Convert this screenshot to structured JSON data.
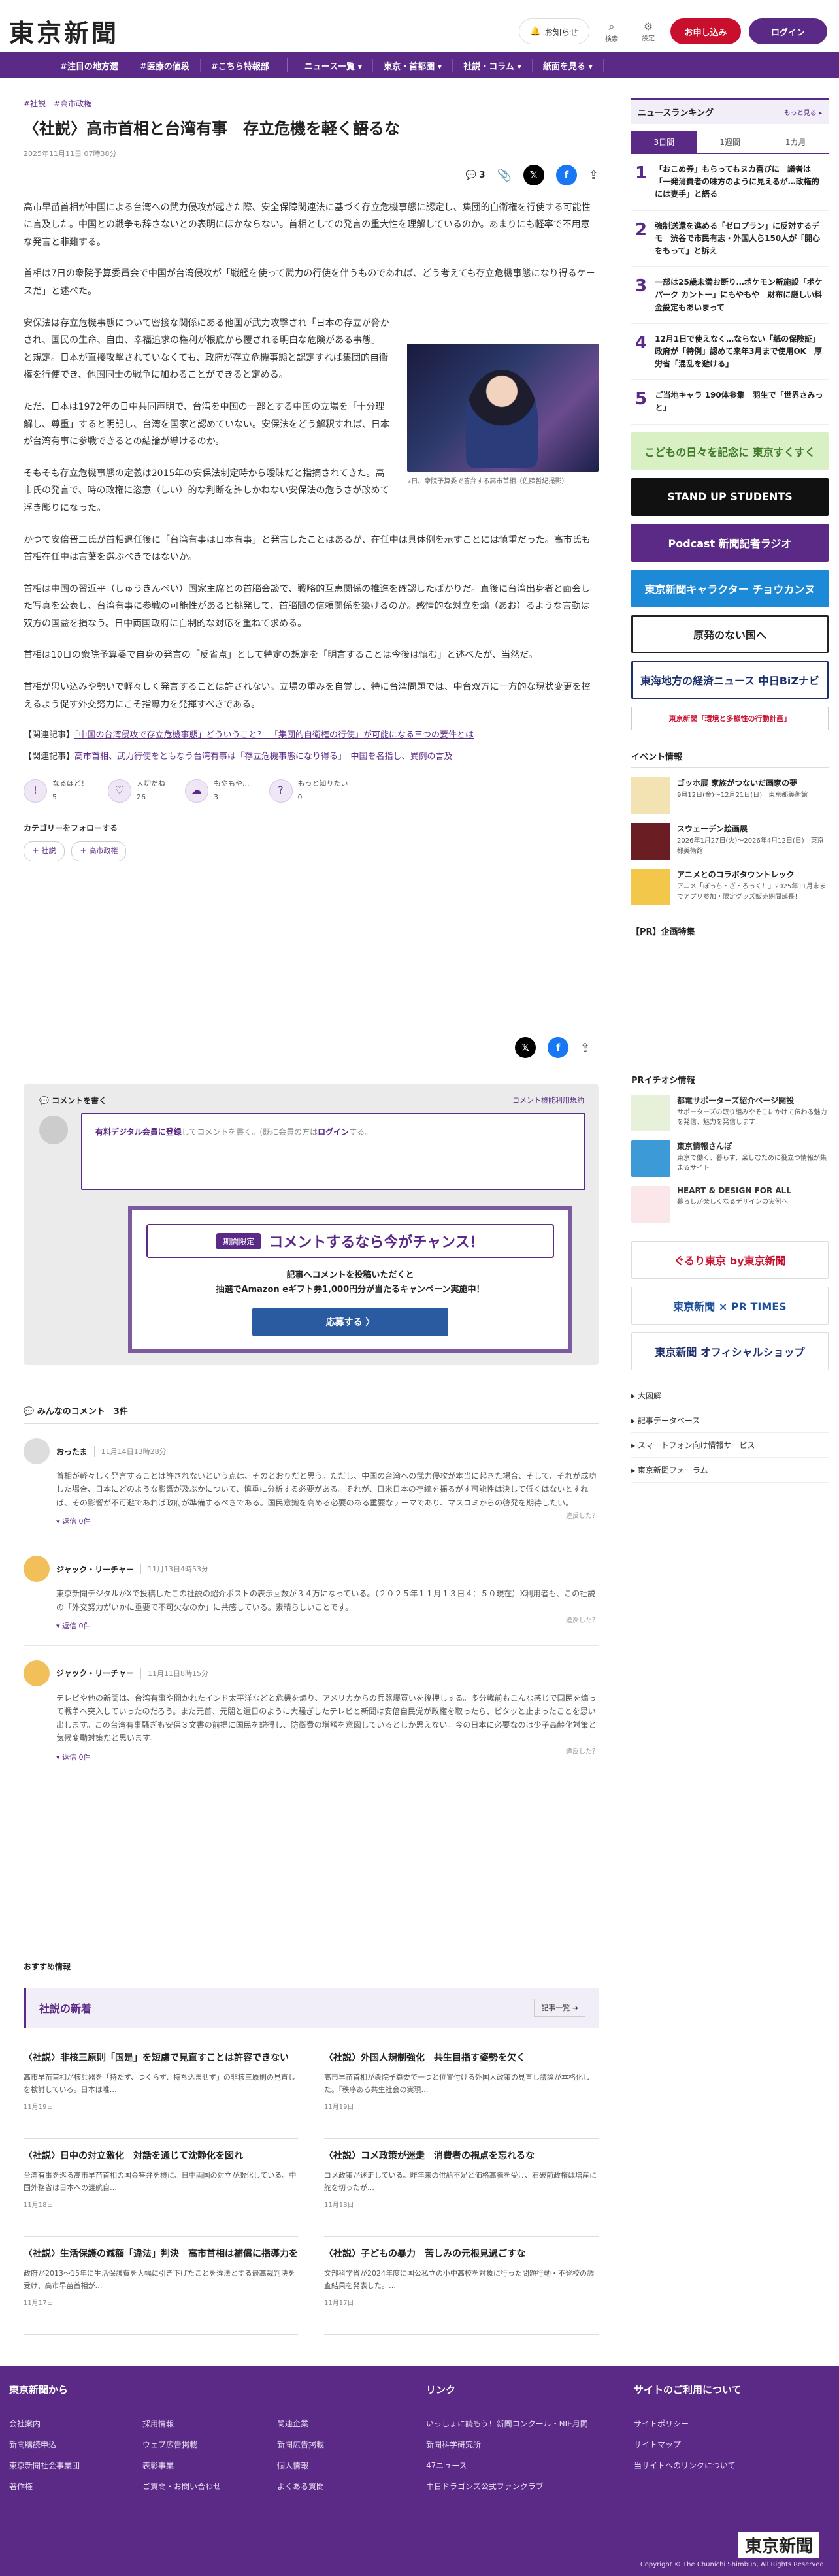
{
  "header": {
    "logo": "東京新聞",
    "notifications": "お知らせ",
    "search": "検索",
    "settings": "設定",
    "apply": "お申し込み",
    "login": "ログイン"
  },
  "nav": {
    "left": [
      "#注目の地方選",
      "#医療の値段",
      "#こちら特報部"
    ],
    "right": [
      "ニュース一覧 ▾",
      "東京・首都圏 ▾",
      "社説・コラム ▾",
      "紙面を見る ▾"
    ]
  },
  "article": {
    "tags": [
      "#社説",
      "#高市政権"
    ],
    "title": "〈社説〉高市首相と台湾有事　存立危機を軽く語るな",
    "date": "2025年11月11日 07時38分",
    "comment_count": "3",
    "paragraphs": [
      "高市早苗首相が中国による台湾への武力侵攻が起きた際、安全保障関連法に基づく存立危機事態に認定し、集団的自衛権を行使する可能性に言及した。中国との戦争も辞さないとの表明にほかならない。首相としての発言の重大性を理解しているのか。あまりにも軽率で不用意な発言と非難する。",
      "首相は7日の衆院予算委員会で中国が台湾侵攻が「戦艦を使って武力の行使を伴うものであれば、どう考えても存立危機事態になり得るケースだ」と述べた。",
      "安保法は存立危機事態について密接な関係にある他国が武力攻撃され「日本の存立が脅かされ、国民の生命、自由、幸福追求の権利が根底から覆される明白な危険がある事態」と規定。日本が直接攻撃されていなくても、政府が存立危機事態と認定すれば集団的自衛権を行使でき、他国同士の戦争に加わることができると定める。",
      "ただ、日本は1972年の日中共同声明で、台湾を中国の一部とする中国の立場を「十分理解し、尊重」すると明記し、台湾を国家と認めていない。安保法をどう解釈すれば、日本が台湾有事に参戦できるとの結論が導けるのか。",
      "そもそも存立危機事態の定義は2015年の安保法制定時から曖昧だと指摘されてきた。高市氏の発言で、時の政権に恣意（しい）的な判断を許しかねない安保法の危うさが改めて浮き彫りになった。",
      "かつて安倍晋三氏が首相退任後に「台湾有事は日本有事」と発言したことはあるが、在任中は具体例を示すことには慎重だった。高市氏も首相在任中は言葉を選ぶべきではないか。",
      "首相は中国の習近平（しゅうきんぺい）国家主席との首脳会談で、戦略的互恵関係の推進を確認したばかりだ。直後に台湾出身者と面会した写真を公表し、台湾有事に参戦の可能性があると挑発して、首脳間の信頼関係を築けるのか。感情的な対立を煽（あお）るような言動は双方の国益を損なう。日中両国政府に自制的な対応を重ねて求める。",
      "首相は10日の衆院予算委で自身の発言の「反省点」として特定の想定を「明言することは今後は慎む」と述べたが、当然だ。",
      "首相が思い込みや勢いで軽々しく発言することは許されない。立場の重みを自覚し、特に台湾問題では、中台双方に一方的な現状変更を控えるよう促す外交努力にこそ指導力を発揮すべきである。"
    ],
    "figure_caption": "7日、衆院予算委で答弁する高市首相（佐藤哲紀撮影）",
    "related": [
      {
        "label": "【関連記事】",
        "text": "「中国の台湾侵攻で存立危機事態」どういうこと？　「集団的自衛権の行使」が可能になる三つの要件とは"
      },
      {
        "label": "【関連記事】",
        "text": "高市首相、武力行使をともなう台湾有事は「存立危機事態になり得る」　中国を名指し、異例の言及"
      }
    ],
    "reactions": [
      {
        "label": "なるほど！",
        "count": "5"
      },
      {
        "label": "大切だね",
        "count": "26"
      },
      {
        "label": "もやもや...",
        "count": "3"
      },
      {
        "label": "もっと知りたい",
        "count": "0"
      }
    ],
    "follow_label": "カテゴリーをフォローする",
    "follow_tags": [
      "＋ 社説",
      "＋ 高市政権"
    ]
  },
  "comment_box": {
    "header": "コメントを書く",
    "policy": "コメント機能利用規約",
    "prompt_link": "有料デジタル会員に登録",
    "prompt_rest": "してコメントを書く。(既に会員の方は",
    "login_link": "ログイン",
    "prompt_end": "する。",
    "campaign_tag": "期間限定",
    "campaign_title": "コメントするなら今がチャンス！",
    "campaign_line1": "記事へコメントを投稿いただくと",
    "campaign_line2": "抽選でAmazon eギフト券1,000円分が当たるキャンペーン実施中！",
    "campaign_button": "応募する 〉"
  },
  "comments": {
    "title": "みんなのコメント　3件",
    "items": [
      {
        "user": "おったま",
        "date": "11月14日13時28分",
        "text": "首相が軽々しく発言することは許されないという点は、そのとおりだと思う。ただし、中国の台湾への武力侵攻が本当に起きた場合、そして、それが成功した場合、日本にどのような影響が及ぶかについて、慎重に分析する必要がある。それが、日米日本の存続を揺るがす可能性は決して低くはないとすれば、その影響が不可避であれば政府が準備するべきである。国民意識を高める必要のある重要なテーマであり、マスコミからの啓発を期待したい。",
        "reply": "▾ 返信  0件",
        "report": "違反した？"
      },
      {
        "user": "ジャック・リーチャー",
        "date": "11月13日4時53分",
        "text": "東京新聞デジタルがXで投稿したこの社説の紹介ポストの表示回数が３４万になっている。（２０２５年１１月１３日４：５０現在）X利用者も、この社説の「外交努力がいかに重要で不可欠なのか」に共感している。素晴らしいことです。",
        "reply": "▾ 返信  0件",
        "report": "違反した？"
      },
      {
        "user": "ジャック・リーチャー",
        "date": "11月11日8時15分",
        "text": "テレビや他の新聞は、台湾有事や開かれたインド太平洋などと危機を煽り、アメリカからの兵器爆買いを後押しする。多分戦前もこんな感じで国民を煽って戦争へ突入していったのだろう。また元首、元閣と遺日のように大騒ぎしたテレビと新聞は安倍自民党が政権を取ったら、ピタッと止まったことを思い出します。この台湾有事騒ぎも安保３文書の前提に国民を説得し、防衛費の増額を意図しているとしか思えない。今の日本に必要なのは少子高齢化対策と気候変動対策だと思います。",
        "reply": "▾ 返信  0件",
        "report": "違反した？"
      }
    ]
  },
  "recommend": {
    "label": "おすすめ情報",
    "section_title": "社説の新着",
    "list_link": "記事一覧 ➜",
    "articles": [
      {
        "title": "〈社説〉非核三原則「国是」を短慮で見直すことは許容できない",
        "excerpt": "高市早苗首相が核兵器を「持たず、つくらず、持ち込ませず」の非核三原則の見直しを検討している。日本は唯…",
        "date": "11月19日"
      },
      {
        "title": "〈社説〉外国人規制強化　共生目指す姿勢を欠く",
        "excerpt": "高市早苗首相が衆院予算委で一つと位置付ける外国人政策の見直し議論が本格化した。「秩序ある共生社会の実現…",
        "date": "11月19日"
      },
      {
        "title": "〈社説〉日中の対立激化　対話を通じて沈静化を図れ",
        "excerpt": "台湾有事を巡る高市早苗首相の国会答弁を機に、日中両国の対立が激化している。中国外務省は日本への渡航自…",
        "date": "11月18日"
      },
      {
        "title": "〈社説〉コメ政策が迷走　消費者の視点を忘れるな",
        "excerpt": "コメ政策が迷走している。昨年来の供給不足と価格高騰を受け、石破前政権は増産に舵を切ったが…",
        "date": "11月18日"
      },
      {
        "title": "〈社説〉生活保護の減額「違法」判決　高市首相は補償に指導力を",
        "excerpt": "政府が2013〜15年に生活保護費を大幅に引き下げたことを違法とする最高裁判決を受け、高市早苗首相が…",
        "date": "11月17日"
      },
      {
        "title": "〈社説〉子どもの暴力　苦しみの元根見過ごすな",
        "excerpt": "文部科学省が2024年度に国公私立の小中高校を対象に行った問題行動・不登校の調査結果を発表した。…",
        "date": "11月17日"
      }
    ]
  },
  "sidebar": {
    "ranking_title": "ニュースランキング",
    "ranking_more": "もっと見る ▸",
    "tabs": [
      "3日間",
      "1週間",
      "1カ月"
    ],
    "ranking": [
      {
        "n": "1",
        "text": "「おこめ券」もらってもヌカ喜びに　議者は「一発消費者の味方のように見えるが…政権的には妻手」と語る"
      },
      {
        "n": "2",
        "text": "強制送還を進める「ゼロプラン」に反対するデモ　渋谷で市民有志・外国人ら150人が「開心をもって」と訴え"
      },
      {
        "n": "3",
        "text": "一部は25歳未満お断り…ポケモン新施設「ポケパーク カントー」にもやもや　財布に厳しい料金設定もあいまって"
      },
      {
        "n": "4",
        "text": "12月1日で使えなく…ならない「紙の保険証」　政府が「特例」認めて来年3月まで使用OK　厚労省「混乱を避ける」"
      },
      {
        "n": "5",
        "text": "ご当地キャラ 190体参集　羽生で「世界さみっと」"
      }
    ],
    "banners": [
      "こどもの日々を記念に 東京すくすく",
      "STAND UP STUDENTS",
      "Podcast 新聞記者ラジオ",
      "東京新聞キャラクター チョウカンヌ",
      "原発のない国へ",
      "東海地方の経済ニュース 中日BiZナビ",
      "東京新聞「環境と多様性の行動計画」"
    ],
    "events_title": "イベント情報",
    "events": [
      {
        "title": "ゴッホ展 家族がつないだ画家の夢",
        "sub": "9月12日(金)〜12月21日(日)　東京都美術館"
      },
      {
        "title": "スウェーデン絵画展",
        "sub": "2026年1月27日(火)〜2026年4月12日(日)　東京都美術館"
      },
      {
        "title": "アニメとのコラボタウントレック",
        "sub": "アニメ「ぼっち・ざ・ろっく！」2025年11月末までアプリ参加・限定グッズ販売期間延長！"
      }
    ],
    "pr_title": "【PR】企画特集",
    "pr_ichioshi": "PRイチオシ情報",
    "pr_items": [
      {
        "title": "都電サポーターズ紹介ページ開設",
        "sub": "サポーターズの取り組みやそこにかけて伝わる魅力を発信、魅力を発信します！"
      },
      {
        "title": "東京情報さんぽ",
        "sub": "東京で働く、暮らす、楽しむために役立つ情報が集まるサイト"
      },
      {
        "title": "HEART & DESIGN FOR ALL",
        "sub": "暮らしが楽しくなるデザインの実例へ"
      }
    ],
    "more_banners": [
      "ぐるり東京 by東京新聞",
      "東京新聞 × PR TIMES",
      "東京新聞 オフィシャルショップ"
    ],
    "links": [
      "大図解",
      "記事データベース",
      "スマートフォン向け情報サービス",
      "東京新聞フォーラム"
    ]
  },
  "footer": {
    "col1_title": "東京新聞から",
    "col1": [
      "会社案内",
      "新聞購読申込",
      "東京新聞社会事業団",
      "著作権"
    ],
    "col2": [
      "採用情報",
      "ウェブ広告掲載",
      "表彰事業",
      "ご質問・お問い合わせ"
    ],
    "col3": [
      "関連企業",
      "新聞広告掲載",
      "個人情報",
      "よくある質問"
    ],
    "col4_title": "リンク",
    "col4": [
      "いっしょに読もう！新聞コンクール・NIE月間",
      "新聞科学研究所",
      "47ニュース",
      "中日ドラゴンズ公式ファンクラブ"
    ],
    "col5_title": "サイトのご利用について",
    "col5": [
      "サイトポリシー",
      "サイトマップ",
      "当サイトへのリンクについて"
    ],
    "logo": "東京新聞",
    "copyright": "Copyright © The Chunichi Shimbun, All Rights Reserved."
  }
}
